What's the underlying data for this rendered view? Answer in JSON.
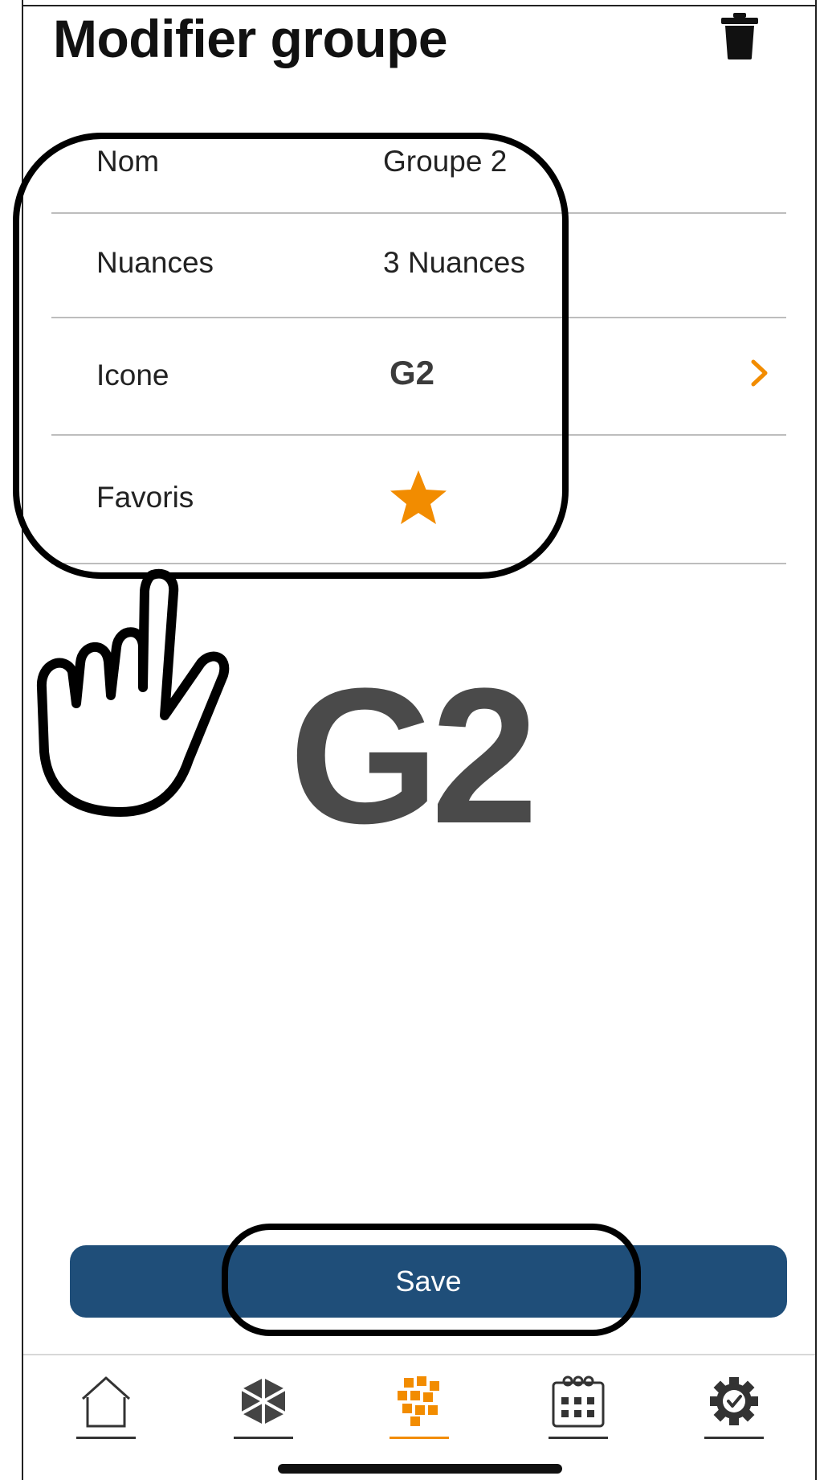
{
  "header": {
    "title": "Modifier groupe",
    "delete_icon": "trash-icon"
  },
  "form": {
    "rows": [
      {
        "label": "Nom",
        "value": "Groupe 2"
      },
      {
        "label": "Nuances",
        "value": "3 Nuances"
      },
      {
        "label": "Icone",
        "value": "G2",
        "trailing_icon": "chevron-right-icon"
      },
      {
        "label": "Favoris",
        "icon": "star-icon",
        "favorite": true
      }
    ]
  },
  "preview": {
    "icon_text": "G2"
  },
  "actions": {
    "save_label": "Save"
  },
  "bottom_nav": {
    "items": [
      {
        "icon": "home-icon",
        "active": false
      },
      {
        "icon": "cube-icon",
        "active": false
      },
      {
        "icon": "groups-icon",
        "active": true
      },
      {
        "icon": "calendar-icon",
        "active": false
      },
      {
        "icon": "settings-gear-icon",
        "active": false
      }
    ]
  },
  "colors": {
    "accent": "#f28c00",
    "primary": "#1f4e79",
    "divider": "#bdbdbd",
    "icon_text": "#4a4a4a"
  }
}
